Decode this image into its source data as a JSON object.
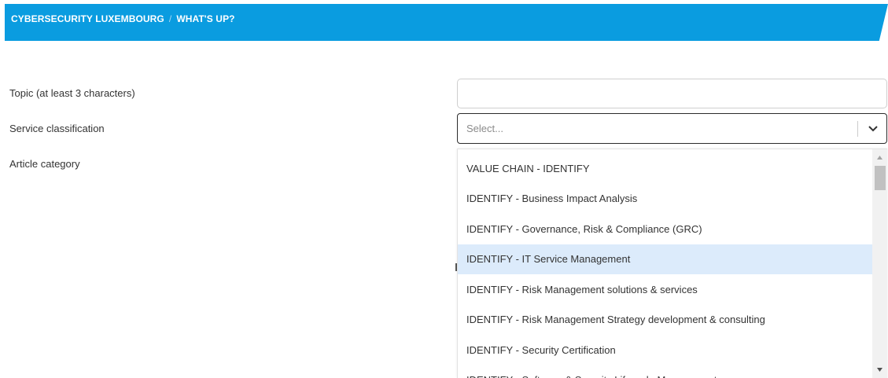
{
  "breadcrumb": {
    "items": [
      "CYBERSECURITY LUXEMBOURG",
      "WHAT'S UP?"
    ],
    "separator": "/"
  },
  "form": {
    "topic_label": "Topic (at least 3 characters)",
    "topic_value": "",
    "service_label": "Service classification",
    "service_placeholder": "Select...",
    "article_label": "Article category"
  },
  "dropdown": {
    "options": [
      "VALUE CHAIN - IDENTIFY",
      "IDENTIFY - Business Impact Analysis",
      "IDENTIFY - Governance, Risk & Compliance (GRC)",
      "IDENTIFY - IT Service Management",
      "IDENTIFY - Risk Management solutions & services",
      "IDENTIFY - Risk Management Strategy development & consulting",
      "IDENTIFY - Security Certification",
      "IDENTIFY - Software & Security Lifecycle Management"
    ],
    "highlighted": "IDENTIFY - IT Service Management"
  },
  "colors": {
    "header_bg": "#0a9ce0",
    "highlight": "#dcebfb",
    "text": "#333333"
  },
  "icons": {
    "select_toggle": "chevron-down-icon",
    "scroll_up": "triangle-up-icon",
    "scroll_down": "triangle-down-icon"
  }
}
